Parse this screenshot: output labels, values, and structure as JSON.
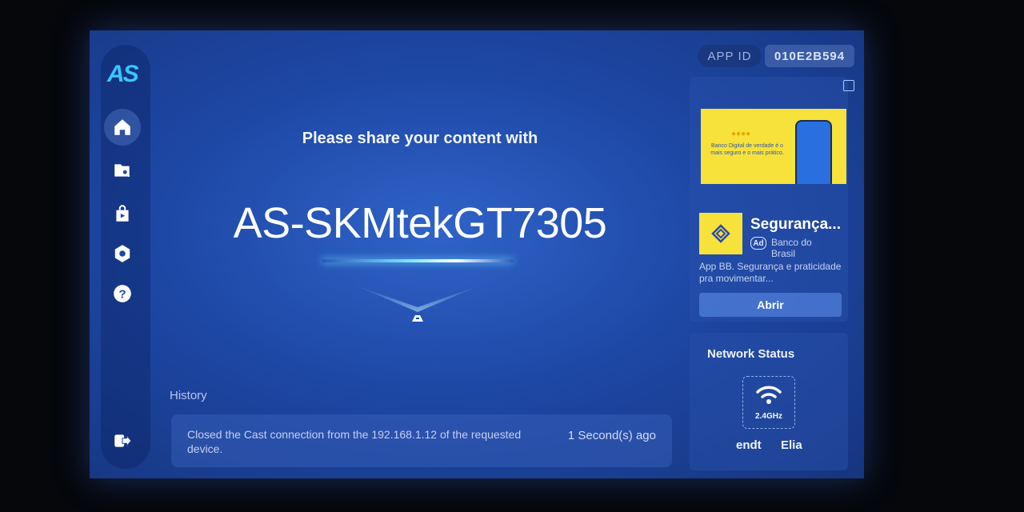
{
  "app": {
    "logo": "AS",
    "brand_color": "#39c6ff"
  },
  "sidebar": {
    "items": [
      {
        "name": "home",
        "icon": "home-icon",
        "active": true
      },
      {
        "name": "file-browser",
        "icon": "folder-search-icon",
        "active": false
      },
      {
        "name": "media-store",
        "icon": "shopping-bag-play-icon",
        "active": false
      },
      {
        "name": "settings",
        "icon": "gear-icon",
        "active": false
      },
      {
        "name": "help",
        "icon": "question-icon",
        "active": false
      },
      {
        "name": "exit",
        "icon": "exit-icon",
        "active": false
      }
    ]
  },
  "main": {
    "share_prompt": "Please share your content with",
    "device_name": "AS-SKMtekGT7305"
  },
  "history": {
    "label": "History",
    "entries": [
      {
        "text": "Closed the Cast connection from the 192.168.1.12 of the requested device.",
        "time": "1 Second(s) ago"
      }
    ]
  },
  "app_id": {
    "label": "APP ID",
    "value": "010E2B594"
  },
  "ad": {
    "banner_text": "Banco Digital de verdade é o mais seguro e o mais prático.",
    "title": "Segurança...",
    "badge": "Ad",
    "advertiser": "Banco do Brasil",
    "description": "App BB. Segurança e praticidade pra movimentar...",
    "cta": "Abrir",
    "banner_color": "#f7e23b"
  },
  "network": {
    "title": "Network Status",
    "band": "2.4GHz",
    "ssid_parts": [
      "endt",
      "Elia"
    ]
  }
}
